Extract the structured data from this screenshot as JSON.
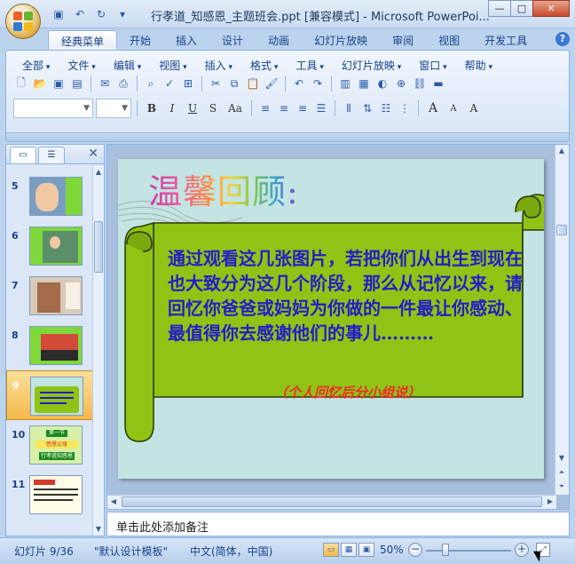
{
  "window": {
    "title": "行孝道_知感恩_主题班会.ppt [兼容模式] - Microsoft PowerPoi...",
    "controls": {
      "minimize": "—",
      "maximize": "□",
      "close": "✕"
    }
  },
  "quick_access": [
    "save-icon",
    "undo-icon",
    "redo-icon",
    "qat-dropdown-icon"
  ],
  "ribbon": {
    "tabs": [
      "经典菜单",
      "开始",
      "插入",
      "设计",
      "动画",
      "幻灯片放映",
      "审阅",
      "视图",
      "开发工具"
    ],
    "active_tab": "经典菜单",
    "help": "?",
    "menus": [
      "全部",
      "文件",
      "编辑",
      "视图",
      "插入",
      "格式",
      "工具",
      "幻灯片放映",
      "窗口",
      "帮助"
    ],
    "font_buttons": {
      "bold": "B",
      "italic": "I",
      "underline": "U",
      "strike": "S",
      "case": "Aa",
      "grow": "A",
      "shrink": "A",
      "clear": "A"
    }
  },
  "left_panel": {
    "tabs": [
      "slides-tab",
      "outline-tab"
    ],
    "close": "✕",
    "slides": [
      {
        "num": "5"
      },
      {
        "num": "6"
      },
      {
        "num": "7"
      },
      {
        "num": "8"
      },
      {
        "num": "9",
        "selected": true
      },
      {
        "num": "10"
      },
      {
        "num": "11"
      }
    ],
    "thumb_texts": {
      "t10_title": "第一节",
      "t10_sub": "感恩父母",
      "t10_sub2": "行孝道知感恩"
    }
  },
  "slide": {
    "title": "温馨回顾:",
    "body": "通过观看这几张图片，若把你们从出生到现在也大致分为这几个阶段，那么从记忆以来，请回忆你爸爸或妈妈为你做的一件最让你感动、最值得你去感谢他们的事儿………",
    "note": "（个人回忆后分小组说）",
    "colors": {
      "background": "#c3e4e2",
      "scroll": "#8fc314",
      "body_text": "#1f1ec9",
      "note_text": "#ee2a2a"
    }
  },
  "notes": {
    "placeholder": "单击此处添加备注"
  },
  "status": {
    "slide_counter": "幻灯片 9/36",
    "template": "\"默认设计模板\"",
    "language": "中文(简体，中国)",
    "zoom": "50%",
    "zoom_minus": "−",
    "zoom_plus": "+"
  }
}
